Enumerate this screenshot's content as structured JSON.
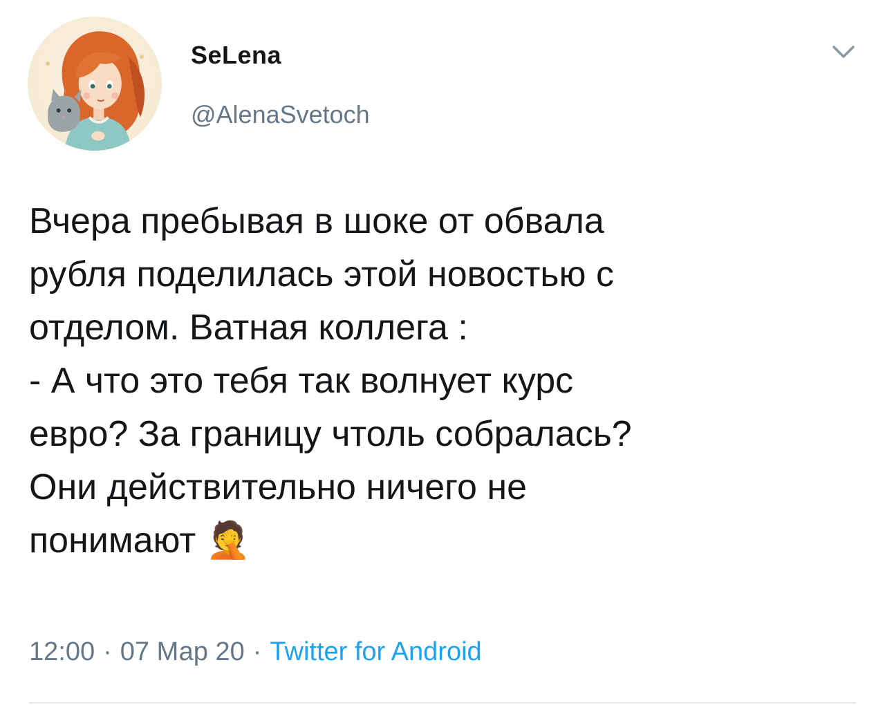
{
  "tweet": {
    "author": {
      "display_name": "SeLena",
      "handle": "@AlenaSvetoch",
      "avatar_icon": "illustrated-girl-with-cat-avatar"
    },
    "menu_icon": "chevron-down-icon",
    "text": "Вчера пребывая в шоке от обвала\nрубля поделилась этой новостью с\nотделом. Ватная коллега :\n- А что это тебя так волнует курс\nевро? За границу чтоль собралась?\nОни действительно ничего не\nпонимают 🤦",
    "time": "12:00",
    "date": "07 Мар 20",
    "separator": "·",
    "source": "Twitter for Android"
  },
  "colors": {
    "text": "#14171a",
    "secondary": "#657786",
    "link": "#1da1f2",
    "divider": "#e6ecf0"
  }
}
